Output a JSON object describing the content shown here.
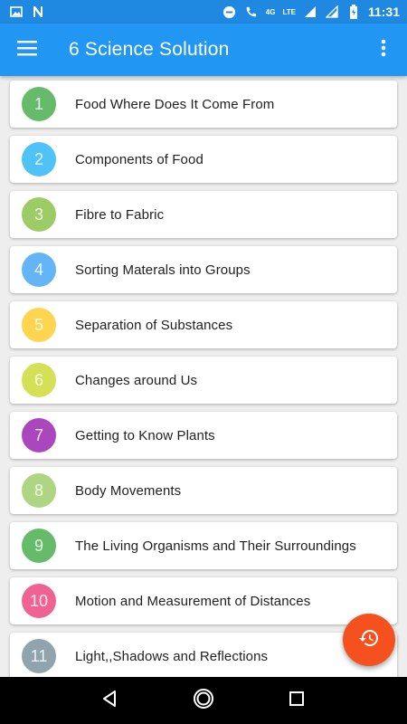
{
  "status_bar": {
    "network_label": "4G",
    "lte_label": "LTE",
    "time": "11:31",
    "icons": [
      "image-icon",
      "n-notification-icon",
      "do-not-disturb-icon",
      "wifi-calling-icon",
      "signal-icon",
      "signal-icon-2",
      "battery-icon"
    ]
  },
  "app_bar": {
    "title": "6 Science Solution",
    "menu_icon": "hamburger-menu-icon",
    "more_icon": "more-vert-icon"
  },
  "chapters": [
    {
      "number": "1",
      "title": "Food Where Does It Come From",
      "color": "#66bb6a"
    },
    {
      "number": "2",
      "title": "Components of Food",
      "color": "#4fc3f7"
    },
    {
      "number": "3",
      "title": "Fibre to Fabric",
      "color": "#9ccc65"
    },
    {
      "number": "4",
      "title": "Sorting Materals into Groups",
      "color": "#64b5f6"
    },
    {
      "number": "5",
      "title": "Separation of Substances",
      "color": "#ffd54f"
    },
    {
      "number": "6",
      "title": "Changes around Us",
      "color": "#d4e157"
    },
    {
      "number": "7",
      "title": "Getting to Know Plants",
      "color": "#ab47bc"
    },
    {
      "number": "8",
      "title": "Body Movements",
      "color": "#aed581"
    },
    {
      "number": "9",
      "title": "The Living Organisms and Their Surroundings",
      "color": "#66bb6a"
    },
    {
      "number": "10",
      "title": "Motion and Measurement of Distances",
      "color": "#f06292"
    },
    {
      "number": "11",
      "title": "Light,,Shadows and Reflections",
      "color": "#90a4ae"
    }
  ],
  "fab": {
    "icon": "history-icon",
    "color": "#f4511e"
  },
  "nav_bar": {
    "icons": [
      "back-icon",
      "home-icon",
      "recents-icon"
    ]
  }
}
